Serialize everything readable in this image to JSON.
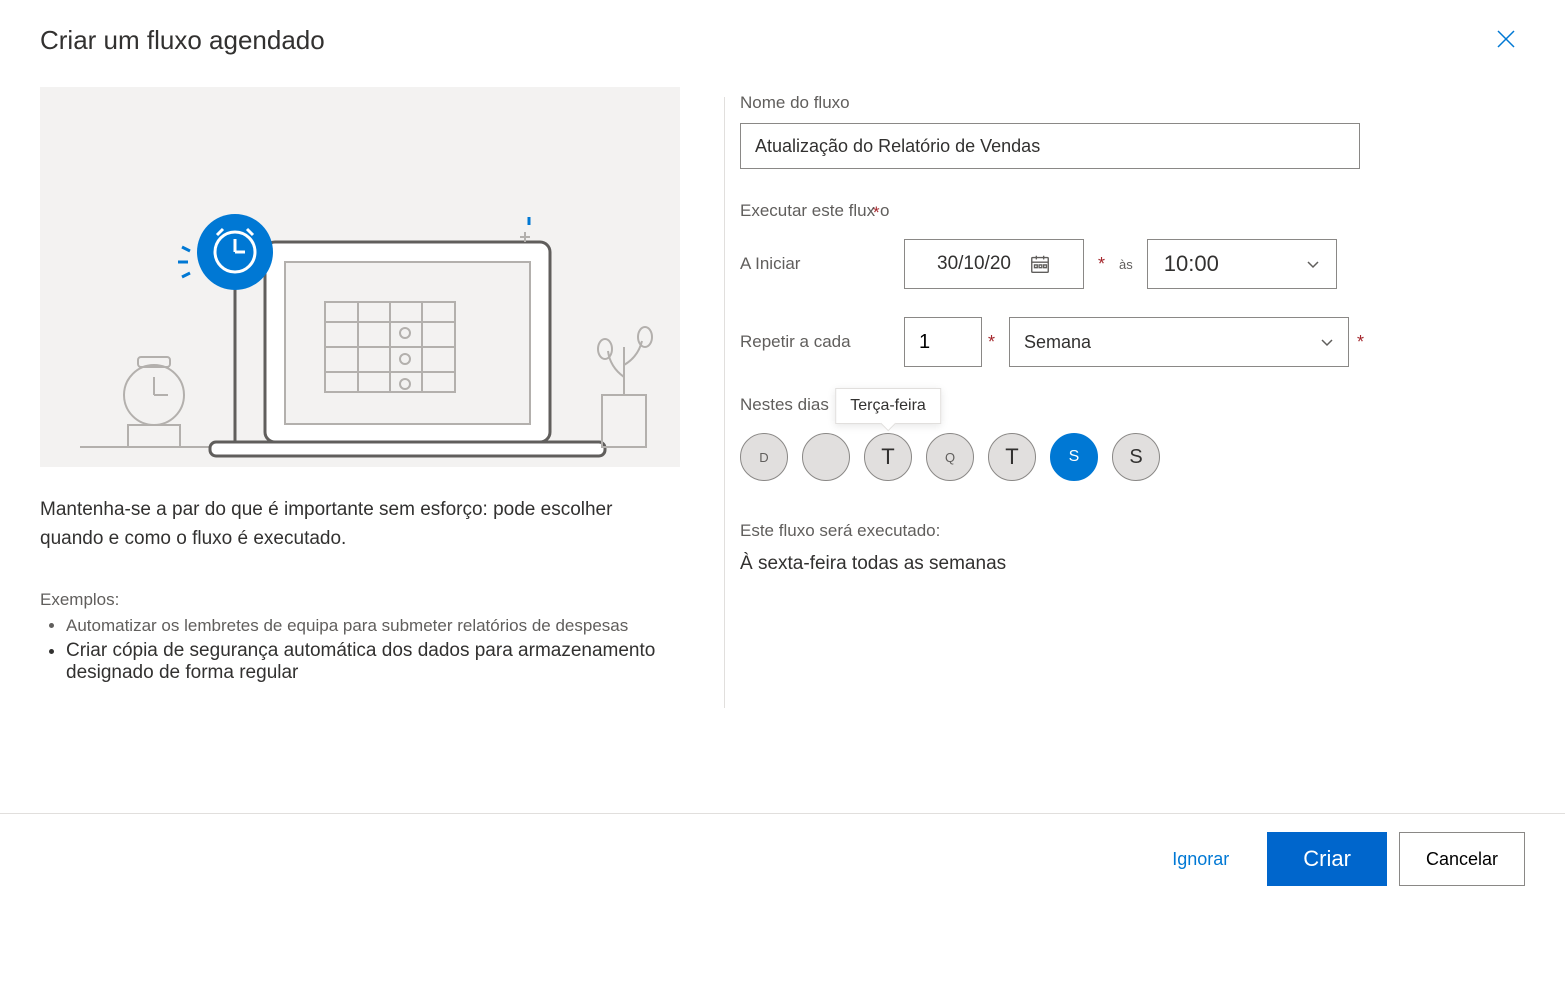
{
  "header": {
    "title": "Criar um fluxo agendado"
  },
  "left": {
    "description": "Mantenha-se a par do que é importante sem esforço: pode escolher quando e como o fluxo é executado.",
    "examples_label": "Exemplos:",
    "examples": [
      "Automatizar os lembretes de equipa para submeter relatórios de despesas",
      "Criar cópia de segurança automática dos dados para armazenamento designado de forma regular"
    ]
  },
  "form": {
    "flow_name_label": "Nome do fluxo",
    "flow_name_value": "Atualização do Relatório de Vendas",
    "run_label": "Executar este flux",
    "start_label": "A Iniciar",
    "start_date": "30/10/20",
    "at_label": "às",
    "start_time": "10:00",
    "repeat_label": "Repetir a cada",
    "repeat_count": "1",
    "repeat_unit": "Semana",
    "days_label": "Nestes dias",
    "days": [
      {
        "letter": "D",
        "selected": false
      },
      {
        "letter": "",
        "selected": false
      },
      {
        "letter": "T",
        "selected": false,
        "tooltip": "Terça-feira"
      },
      {
        "letter": "Q",
        "selected": false
      },
      {
        "letter": "T",
        "selected": false
      },
      {
        "letter": "S",
        "selected": true
      },
      {
        "letter": "S",
        "selected": false
      }
    ],
    "summary_label": "Este fluxo será executado:",
    "summary_text": "À sexta-feira todas as semanas"
  },
  "footer": {
    "ignore": "Ignorar",
    "create": "Criar",
    "cancel": "Cancelar"
  }
}
